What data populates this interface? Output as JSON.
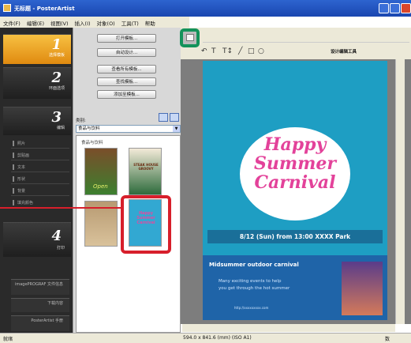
{
  "window": {
    "title": "无标题 - PosterArtist"
  },
  "menu": {
    "items": [
      "文件(F)",
      "编辑(E)",
      "视图(V)",
      "插入(I)",
      "对象(O)",
      "工具(T)",
      "帮助"
    ]
  },
  "steps": [
    {
      "num": "1",
      "label": "选择模板"
    },
    {
      "num": "2",
      "label": "环面选项"
    },
    {
      "num": "3",
      "label": "编辑"
    },
    {
      "num": "4",
      "label": "打印"
    }
  ],
  "step3_items": [
    "照片",
    "剪贴画",
    "文本",
    "形状",
    "背景",
    "填充颜色"
  ],
  "sidebar_buttons": [
    "imagePROGRAF 文件信息",
    "下载内容",
    "PosterArtist 手册"
  ],
  "panel": {
    "buttons": [
      "打开模板...",
      "自动设计...",
      "查看所有模板...",
      "查找模板...",
      "添加至模板..."
    ],
    "category_label": "类别:",
    "category_value": "食品与饮料",
    "tree_header": "食品与饮料",
    "thumb_steak": "STEAK HOUSE GROOVY",
    "thumb_open": "Open",
    "thumb_happy": "Happy Summer Carnival"
  },
  "toolbar": {
    "design_tool": "设计编辑工具"
  },
  "poster": {
    "title_lines": [
      "Happy",
      "Summer",
      "Carnival"
    ],
    "date_line": "8/12 (Sun) from 13:00  XXXX Park",
    "subtitle": "Midsummer outdoor carnival",
    "body": [
      "Many exciting events to help",
      "you get through the hot summer"
    ],
    "url": "http://xxxxxxxxx.com"
  },
  "status": {
    "left": "就绪",
    "size": "594.0 x 841.6 (mm) (ISO A1)",
    "right": "数"
  },
  "colors": {
    "poster_bg": "#1e9ec3",
    "accent_red": "#d71f2b",
    "accent_green": "#14925a",
    "step_active": "#f0a020"
  }
}
